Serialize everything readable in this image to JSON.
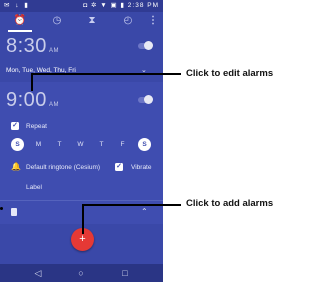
{
  "status_bar": {
    "left_icons": "✉ ↓ ▮",
    "right_icons": "◘ ✲ ▼ ▣ ▮",
    "time": "2:38 PM"
  },
  "tabs": [
    {
      "label": "alarm",
      "icon": "alarm-clock-icon",
      "glyph": "⏰"
    },
    {
      "label": "clock",
      "icon": "clock-icon",
      "glyph": "◷"
    },
    {
      "label": "timer",
      "icon": "hourglass-icon",
      "glyph": "⧗"
    },
    {
      "label": "stopwatch",
      "icon": "stopwatch-icon",
      "glyph": "◴"
    }
  ],
  "alarm1": {
    "time": "8:30",
    "ampm": "AM",
    "days": "Mon, Tue, Wed, Thu, Fri",
    "enabled": false
  },
  "alarm2": {
    "time": "9:00",
    "ampm": "AM",
    "enabled": false,
    "repeat_label": "Repeat",
    "repeat_checked": true,
    "days": [
      {
        "letter": "S",
        "selected": true
      },
      {
        "letter": "M",
        "selected": false
      },
      {
        "letter": "T",
        "selected": false
      },
      {
        "letter": "W",
        "selected": false
      },
      {
        "letter": "T",
        "selected": false
      },
      {
        "letter": "F",
        "selected": false
      },
      {
        "letter": "S",
        "selected": true
      }
    ],
    "ringtone_label": "Default ringtone (Cesium)",
    "vibrate_label": "Vibrate",
    "vibrate_checked": true,
    "label_text": "Label"
  },
  "fab": {
    "glyph": "+"
  },
  "navbar": {
    "back": "◁",
    "home": "○",
    "recents": "□"
  },
  "callouts": {
    "edit": "Click to edit alarms",
    "add": "Click to add alarms"
  },
  "colors": {
    "background": "#3a48a8",
    "expanded": "#3f4db0",
    "fab": "#e53935",
    "status_bar": "#303b93",
    "nav_bar": "#2a3585"
  }
}
